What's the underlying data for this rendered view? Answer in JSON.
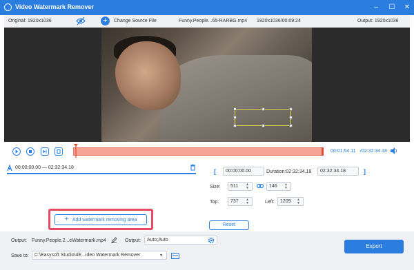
{
  "window": {
    "title": "Video Watermark Remover"
  },
  "infobar": {
    "original": "Original: 1920x1036",
    "change_source": "Change Source File",
    "filename": "Funny.People...65-RARBG.mp4",
    "resolution_duration": "1920x1036/00:09:24",
    "output": "Output: 1920x1036"
  },
  "playback": {
    "current_time": "00:01:54.11",
    "total_time": "/02:32:34.18"
  },
  "segment": {
    "range": "00:00:00.00 — 02:32:34.18"
  },
  "add_area_label": "Add watermark removing area",
  "settings": {
    "start_bracket": "[",
    "start_time": "00:00:00.00",
    "duration_label": "Duration:02:32:34.18",
    "end_time": "02:32:34.18",
    "end_bracket": "]",
    "size_label": "Size:",
    "width": "511",
    "height": "146",
    "top_label": "Top:",
    "top": "737",
    "left_label": "Left:",
    "left": "1209",
    "reset_label": "Reset"
  },
  "bottom": {
    "output_label": "Output:",
    "output_file": "Funny.People.2...eWatermark.mp4",
    "output_format_label": "Output:",
    "output_format": "Auto;Auto",
    "save_to_label": "Save to:",
    "save_path": "C:\\Easysoft Studio\\4E...ideo Watermark Remover",
    "export_label": "Export"
  },
  "colors": {
    "accent": "#2b7ee0",
    "timeline": "#f4a395",
    "highlight": "#e84a63"
  }
}
